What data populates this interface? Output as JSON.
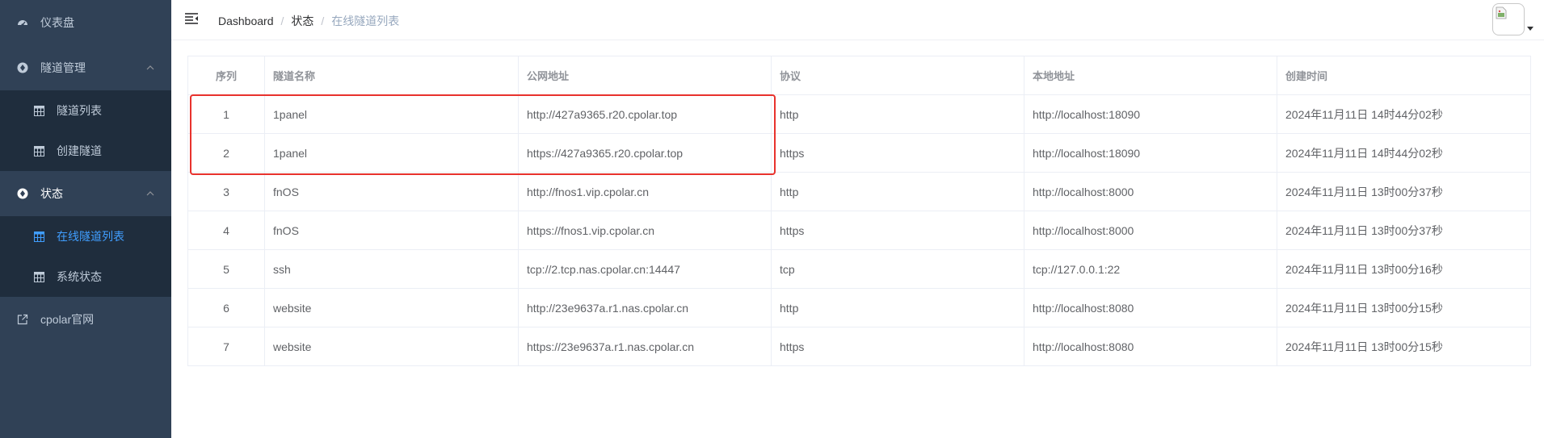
{
  "sidebar": {
    "items": [
      {
        "label": "仪表盘",
        "icon": "dashboard-icon"
      },
      {
        "label": "隧道管理",
        "icon": "tunnel-manage-icon",
        "expanded": true,
        "children": [
          {
            "label": "隧道列表",
            "icon": "table-icon"
          },
          {
            "label": "创建隧道",
            "icon": "table-icon"
          }
        ]
      },
      {
        "label": "状态",
        "icon": "status-icon",
        "expanded": true,
        "children": [
          {
            "label": "在线隧道列表",
            "icon": "table-icon",
            "active": true
          },
          {
            "label": "系统状态",
            "icon": "table-icon"
          }
        ]
      },
      {
        "label": "cpolar官网",
        "icon": "external-link-icon"
      }
    ]
  },
  "header": {
    "breadcrumb": [
      "Dashboard",
      "状态",
      "在线隧道列表"
    ],
    "breadcrumb_sep": "/"
  },
  "table": {
    "columns": [
      "序列",
      "隧道名称",
      "公网地址",
      "协议",
      "本地地址",
      "创建时间"
    ],
    "rows": [
      [
        "1",
        "1panel",
        "http://427a9365.r20.cpolar.top",
        "http",
        "http://localhost:18090",
        "2024年11月11日 14时44分02秒"
      ],
      [
        "2",
        "1panel",
        "https://427a9365.r20.cpolar.top",
        "https",
        "http://localhost:18090",
        "2024年11月11日 14时44分02秒"
      ],
      [
        "3",
        "fnOS",
        "http://fnos1.vip.cpolar.cn",
        "http",
        "http://localhost:8000",
        "2024年11月11日 13时00分37秒"
      ],
      [
        "4",
        "fnOS",
        "https://fnos1.vip.cpolar.cn",
        "https",
        "http://localhost:8000",
        "2024年11月11日 13时00分37秒"
      ],
      [
        "5",
        "ssh",
        "tcp://2.tcp.nas.cpolar.cn:14447",
        "tcp",
        "tcp://127.0.0.1:22",
        "2024年11月11日 13时00分16秒"
      ],
      [
        "6",
        "website",
        "http://23e9637a.r1.nas.cpolar.cn",
        "http",
        "http://localhost:8080",
        "2024年11月11日 13时00分15秒"
      ],
      [
        "7",
        "website",
        "https://23e9637a.r1.nas.cpolar.cn",
        "https",
        "http://localhost:8080",
        "2024年11月11日 13时00分15秒"
      ]
    ]
  },
  "colors": {
    "sidebar_bg": "#304156",
    "submenu_bg": "#1f2d3d",
    "active": "#409eff",
    "highlight": "#e8322d"
  }
}
